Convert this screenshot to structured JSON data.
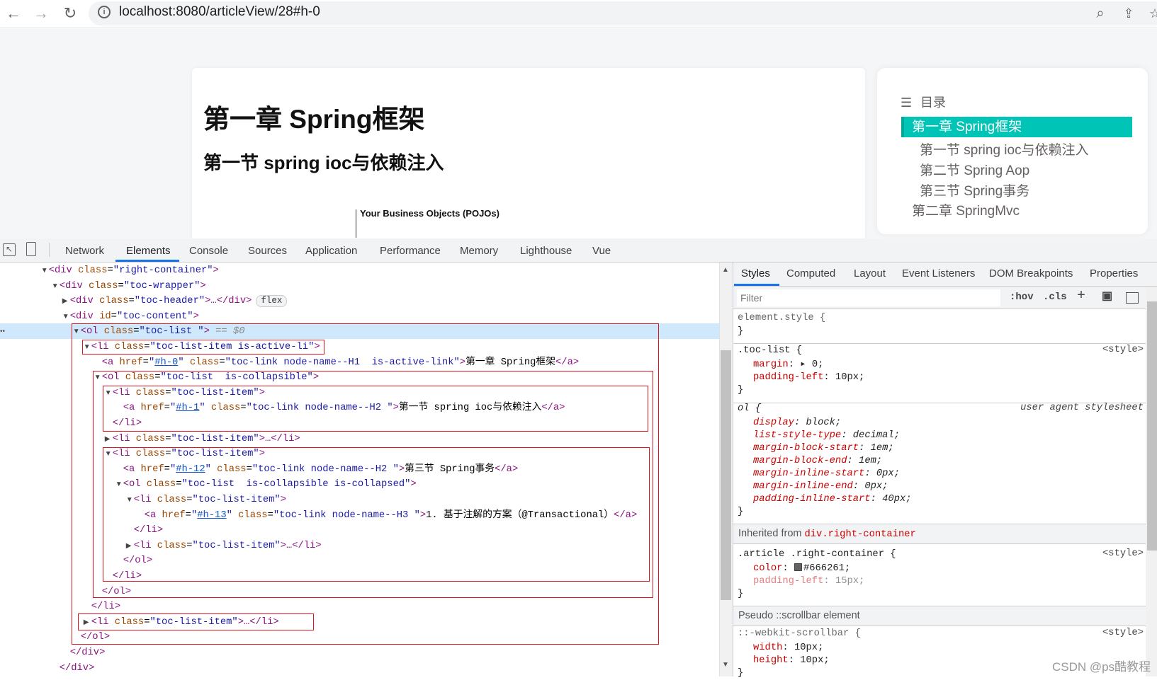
{
  "browser": {
    "url": "localhost:8080/articleView/28#h-0",
    "icons": [
      "back-arrow-icon",
      "forward-arrow-icon",
      "reload-icon",
      "info-icon",
      "zoom-icon",
      "share-icon",
      "star-icon"
    ]
  },
  "article": {
    "h1": "第一章 Spring框架",
    "h2": "第一节 spring ioc与依赖注入",
    "diagram_label": "Your Business Objects (POJOs)"
  },
  "toc": {
    "title": "目录",
    "active": "第一章 Spring框架",
    "items": [
      "第一节 spring ioc与依赖注入",
      "第二节 Spring Aop",
      "第三节 Spring事务",
      "第二章 SpringMvc"
    ],
    "accent": "#00c4b6"
  },
  "devtools": {
    "tabs": [
      "Network",
      "Elements",
      "Console",
      "Sources",
      "Application",
      "Performance",
      "Memory",
      "Lighthouse",
      "Vue"
    ],
    "active_tab": "Elements",
    "dom_lines": [
      "<div class=\"right-container\">",
      "<div class=\"toc-wrapper\">",
      "<div class=\"toc-header\">…</div>",
      "<div id=\"toc-content\">",
      "<ol class=\"toc-list \"> == $0",
      "<li class=\"toc-list-item is-active-li\">",
      "<a href=\"#h-0\" class=\"toc-link node-name--H1  is-active-link\">第一章 Spring框架</a>",
      "<ol class=\"toc-list  is-collapsible\">",
      "<li class=\"toc-list-item\">",
      "<a href=\"#h-1\" class=\"toc-link node-name--H2 \">第一节 spring ioc与依赖注入</a>",
      "</li>",
      "<li class=\"toc-list-item\">…</li>",
      "<li class=\"toc-list-item\">",
      "<a href=\"#h-12\" class=\"toc-link node-name--H2 \">第三节 Spring事务</a>",
      "<ol class=\"toc-list  is-collapsible is-collapsed\">",
      "<li class=\"toc-list-item\">",
      "<a href=\"#h-13\" class=\"toc-link node-name--H3 \">1. 基于注解的方案（@Transactional）</a>",
      "</li>",
      "<li class=\"toc-list-item\">…</li>",
      "</ol>",
      "</li>",
      "</ol>",
      "</li>",
      "<li class=\"toc-list-item\">…</li>",
      "</ol>",
      "</div>",
      "</div>"
    ],
    "flex_badge": "flex",
    "styles": {
      "tabs": [
        "Styles",
        "Computed",
        "Layout",
        "Event Listeners",
        "DOM Breakpoints",
        "Properties"
      ],
      "filter_placeholder": "Filter",
      "hov": ":hov",
      "cls": ".cls",
      "element_style": "element.style {",
      "close": "}",
      "rule1": {
        "selector": ".toc-list {",
        "source": "<style>",
        "props": [
          [
            "margin",
            "▸ 0;"
          ],
          [
            "padding-left",
            "10px;"
          ]
        ]
      },
      "rule2": {
        "selector": "ol {",
        "source": "user agent stylesheet",
        "props": [
          [
            "display",
            "block;"
          ],
          [
            "list-style-type",
            "decimal;"
          ],
          [
            "margin-block-start",
            "1em;"
          ],
          [
            "margin-block-end",
            "1em;"
          ],
          [
            "margin-inline-start",
            "0px;"
          ],
          [
            "margin-inline-end",
            "0px;"
          ],
          [
            "padding-inline-start",
            "40px;"
          ]
        ]
      },
      "inherited_label": "Inherited from ",
      "inherited_from": "div.right-container",
      "rule3": {
        "selector": ".article .right-container {",
        "source": "<style>",
        "props": [
          [
            "color",
            "#666261;"
          ],
          [
            "padding-left",
            "15px;"
          ]
        ]
      },
      "pseudo_label": "Pseudo ::scrollbar element",
      "rule4": {
        "selector": "::-webkit-scrollbar {",
        "source": "<style>",
        "props": [
          [
            "width",
            "10px;"
          ],
          [
            "height",
            "10px;"
          ]
        ]
      }
    }
  },
  "watermark": "CSDN @ps酷教程"
}
